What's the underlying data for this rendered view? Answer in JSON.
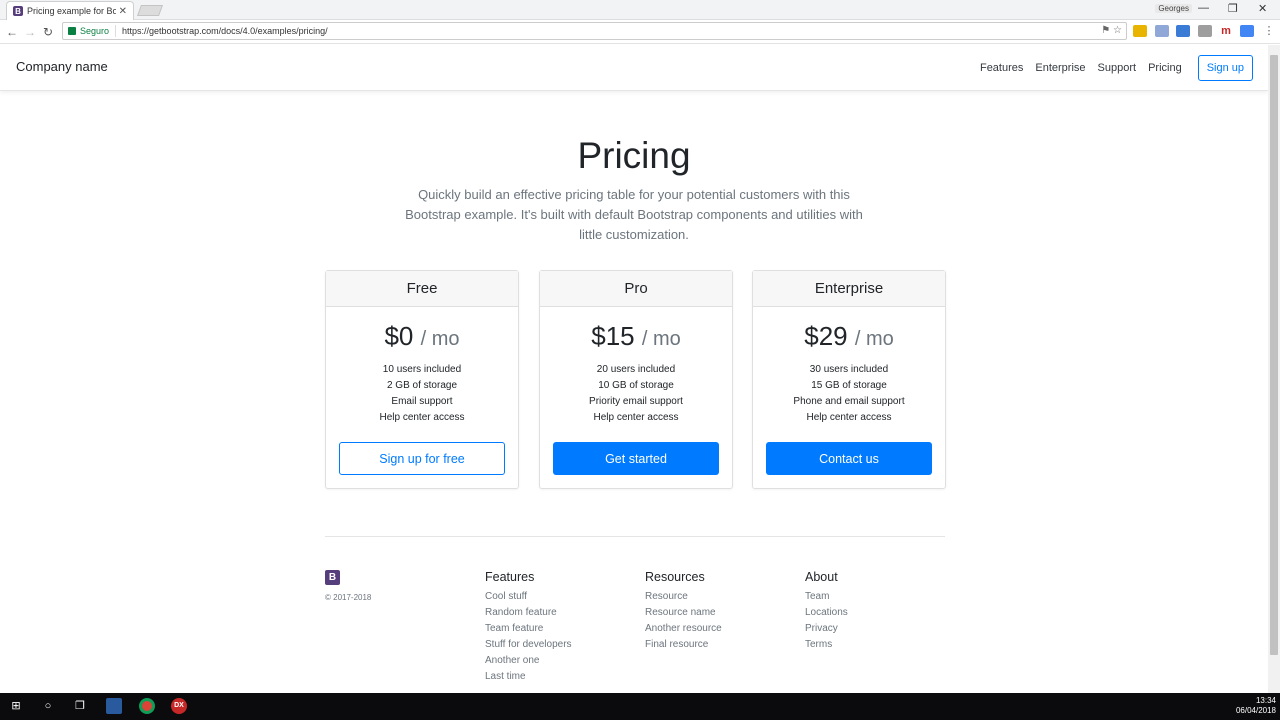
{
  "browser": {
    "tab_title": "Pricing example for Boot",
    "secure_label": "Seguro",
    "url": "https://getbootstrap.com/docs/4.0/examples/pricing/",
    "user_badge": "Georges"
  },
  "navbar": {
    "brand": "Company name",
    "links": [
      "Features",
      "Enterprise",
      "Support",
      "Pricing"
    ],
    "signup": "Sign up"
  },
  "hero": {
    "title": "Pricing",
    "lead": "Quickly build an effective pricing table for your potential customers with this Bootstrap example. It's built with default Bootstrap components and utilities with little customization."
  },
  "plans": [
    {
      "name": "Free",
      "price": "$0",
      "period": "/ mo",
      "features": [
        "10 users included",
        "2 GB of storage",
        "Email support",
        "Help center access"
      ],
      "cta": "Sign up for free"
    },
    {
      "name": "Pro",
      "price": "$15",
      "period": "/ mo",
      "features": [
        "20 users included",
        "10 GB of storage",
        "Priority email support",
        "Help center access"
      ],
      "cta": "Get started"
    },
    {
      "name": "Enterprise",
      "price": "$29",
      "period": "/ mo",
      "features": [
        "30 users included",
        "15 GB of storage",
        "Phone and email support",
        "Help center access"
      ],
      "cta": "Contact us"
    }
  ],
  "footer": {
    "logo": "B",
    "copyright": "© 2017-2018",
    "columns": [
      {
        "title": "Features",
        "items": [
          "Cool stuff",
          "Random feature",
          "Team feature",
          "Stuff for developers",
          "Another one",
          "Last time"
        ]
      },
      {
        "title": "Resources",
        "items": [
          "Resource",
          "Resource name",
          "Another resource",
          "Final resource"
        ]
      },
      {
        "title": "About",
        "items": [
          "Team",
          "Locations",
          "Privacy",
          "Terms"
        ]
      }
    ]
  },
  "taskbar": {
    "time": "13:34",
    "date": "06/04/2018"
  },
  "colors": {
    "primary": "#007bff",
    "bootstrap_purple": "#563d7c",
    "muted": "#6c757d"
  }
}
